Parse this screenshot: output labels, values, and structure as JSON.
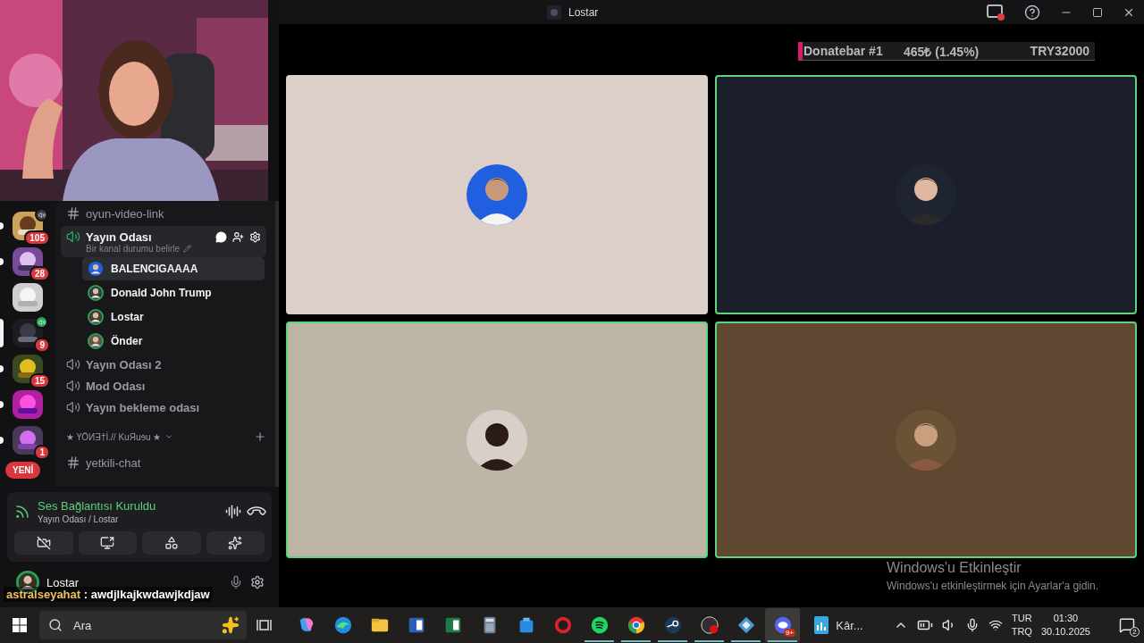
{
  "servers": [
    {
      "badge": "105",
      "unread": true,
      "selected": false,
      "speaker": true,
      "live": false
    },
    {
      "badge": "28",
      "unread": true,
      "selected": false
    },
    {
      "unread": false,
      "selected": false
    },
    {
      "badge": "9",
      "selected": true,
      "speaker": true,
      "live": true
    },
    {
      "badge": "15",
      "unread": true,
      "selected": false
    },
    {
      "unread": true,
      "selected": false
    },
    {
      "badge": "1",
      "unread": true,
      "selected": false
    }
  ],
  "new_pill": "YENİ",
  "channels": [
    {
      "kind": "text",
      "name": "oyun-video-link",
      "selected": false
    },
    {
      "kind": "voice",
      "name": "Yayın Odası",
      "selected": true,
      "status": "Bir kanal durumu belirle",
      "members": [
        {
          "name": "BALENCIGAAAA",
          "selected": true,
          "speaking": false
        },
        {
          "name": "Donald John Trump",
          "selected": false,
          "speaking": true
        },
        {
          "name": "Lostar",
          "selected": false,
          "speaking": true
        },
        {
          "name": "Önder",
          "selected": false,
          "speaking": true
        }
      ]
    },
    {
      "kind": "voice",
      "name": "Yayın Odası 2",
      "selected": false
    },
    {
      "kind": "voice",
      "name": "Mod Odası",
      "selected": false
    },
    {
      "kind": "voice",
      "name": "Yayın bekleme odası",
      "selected": false
    },
    {
      "kind": "category",
      "name": "★ ҮÖИƎ†İ.// KuЯuɘu ★"
    },
    {
      "kind": "text",
      "name": "yetkili-chat",
      "selected": false
    }
  ],
  "voice_panel": {
    "status": "Ses Bağlantısı Kuruldu",
    "location": "Yayın Odası / Lostar"
  },
  "user": {
    "name": "Lostar"
  },
  "chat_overlay": {
    "user": "astralseyahat",
    "separator": ":",
    "message": "awdjlkajkwdawjkdjaw"
  },
  "window": {
    "title": "Lostar"
  },
  "donatebar": {
    "label": "Donatebar #1",
    "amount": "465₺ (1.45%)",
    "goal": "TRY32000",
    "level": 0.0145
  },
  "tiles": [
    {
      "color": "#dccfca",
      "speaking": false
    },
    {
      "color": "#1a1f2b",
      "speaking": true
    },
    {
      "color": "#bdb6a7",
      "speaking": true
    },
    {
      "color": "#5f4731",
      "speaking": true
    }
  ],
  "activation": {
    "title": "Windows'u Etkinleştir",
    "text": "Windows'u etkinleştirmek için Ayarlar'a gidin."
  },
  "taskbar": {
    "search_placeholder": "Ara",
    "apps": [
      {
        "kind": "copilot",
        "running": false,
        "active": false
      },
      {
        "kind": "edge",
        "running": false,
        "active": false
      },
      {
        "kind": "explorer",
        "running": false,
        "active": false
      },
      {
        "kind": "word",
        "running": false,
        "active": false
      },
      {
        "kind": "excel",
        "running": false,
        "active": false
      },
      {
        "kind": "calculator",
        "running": false,
        "active": false
      },
      {
        "kind": "store",
        "running": false,
        "active": false
      },
      {
        "kind": "opera",
        "running": false,
        "active": false
      },
      {
        "kind": "spotify",
        "running": true,
        "active": false
      },
      {
        "kind": "chrome",
        "running": true,
        "active": false
      },
      {
        "kind": "steam",
        "running": true,
        "active": false
      },
      {
        "kind": "obs",
        "running": true,
        "active": false
      },
      {
        "kind": "cube",
        "running": true,
        "active": false
      },
      {
        "kind": "discord",
        "running": true,
        "active": true,
        "badge": "9+"
      }
    ],
    "pinned": "Kâr...",
    "language": "TUR",
    "layout": "TRQ",
    "time": "01:30",
    "date": "30.10.2025",
    "notifications": "2"
  }
}
